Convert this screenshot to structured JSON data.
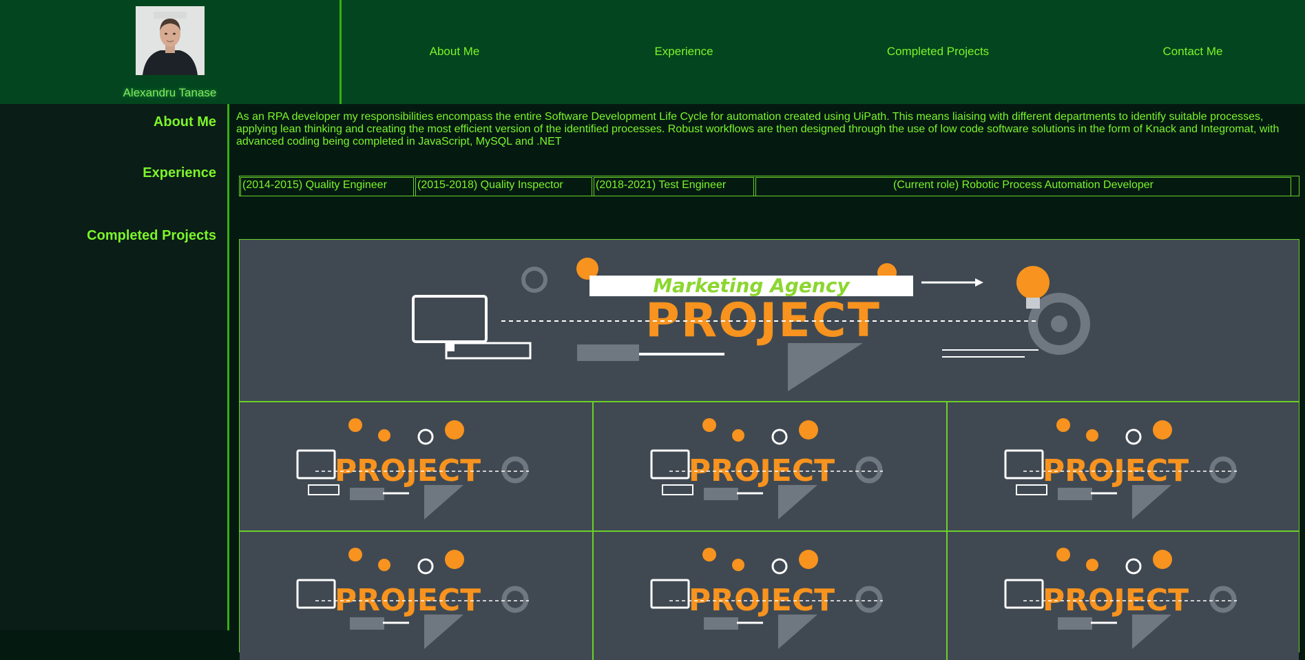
{
  "profile": {
    "name": "Alexandru Tanase"
  },
  "nav": {
    "items": [
      {
        "label": "About Me"
      },
      {
        "label": "Experience"
      },
      {
        "label": "Completed Projects"
      },
      {
        "label": "Contact Me"
      }
    ]
  },
  "sidebar": {
    "about": "About Me",
    "experience": "Experience",
    "projects": "Completed Projects"
  },
  "about": {
    "text": "As an RPA developer my responsibilities encompass the entire Software Development Life Cycle for automation created using UiPath. This means liaising with different departments to identify suitable processes, applying lean thinking and creating the most efficient version of the identified processes. Robust workflows are then designed through the use of low code software solutions in the form of Knack and Integromat, with advanced coding being completed in JavaScript, MySQL and .NET"
  },
  "experience": {
    "roles": [
      "(2014-2015) Quality Engineer",
      "(2015-2018) Quality Inspector",
      "(2018-2021) Test Engineer",
      "(Current role) Robotic Process Automation Developer"
    ]
  },
  "projects": {
    "featured_caption": "Marketing Agency",
    "word": "PROJECT"
  },
  "colors": {
    "accent": "#7cf529",
    "header_bg": "#03451e",
    "page_bg": "#041a11",
    "tile_bg": "#404952",
    "orange": "#f7931e"
  }
}
